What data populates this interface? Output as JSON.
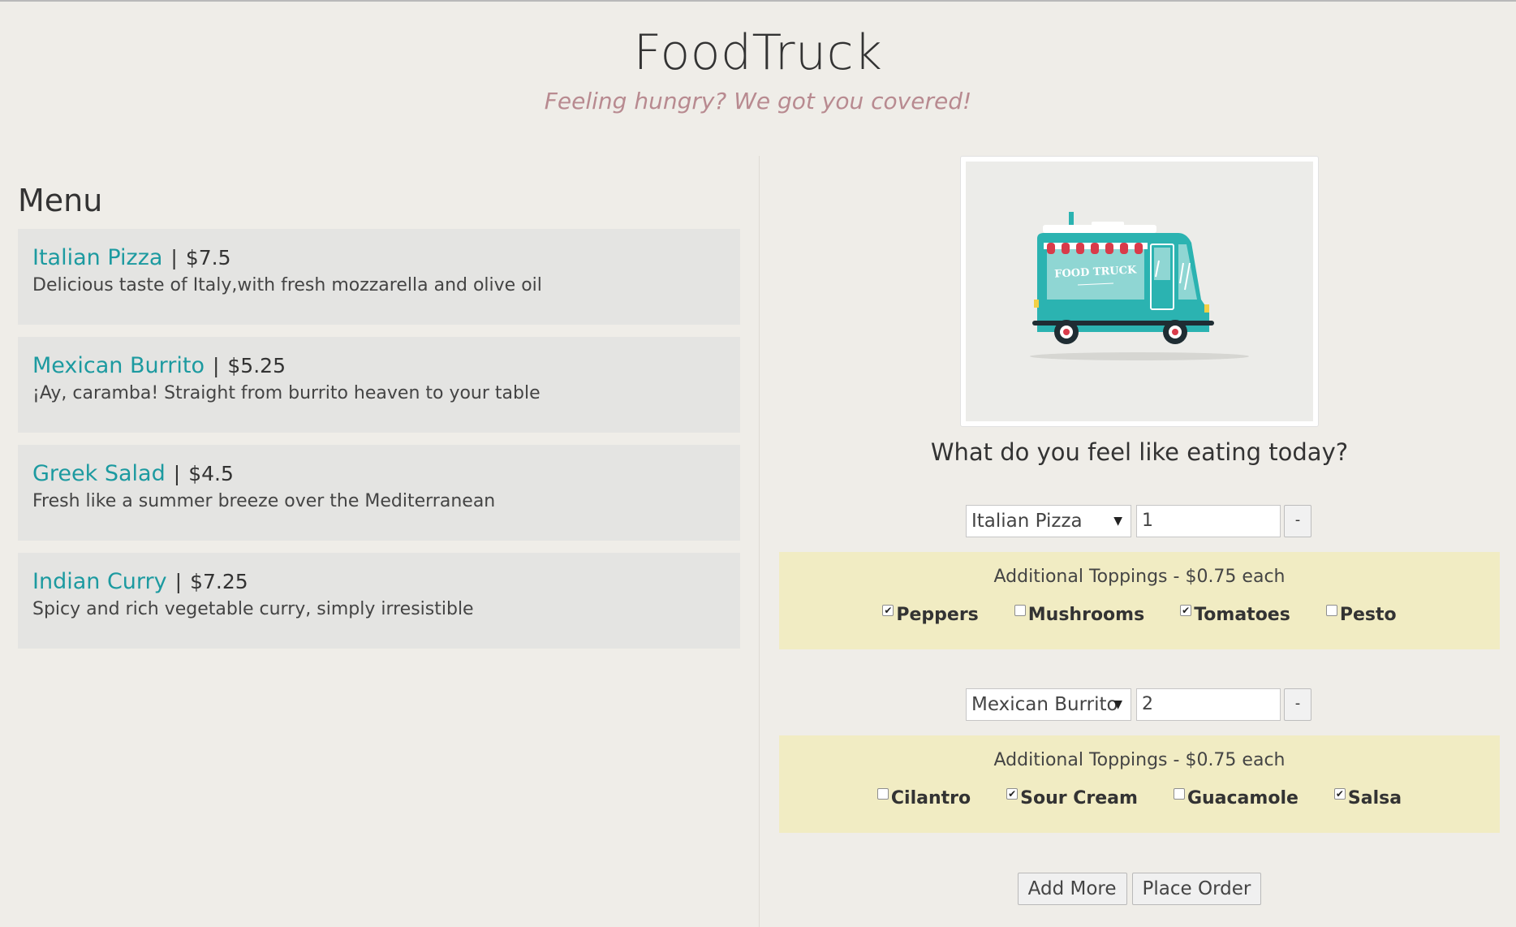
{
  "header": {
    "title": "FoodTruck",
    "tagline": "Feeling hungry? We got you covered!"
  },
  "menu": {
    "heading": "Menu",
    "items": [
      {
        "name": "Italian Pizza",
        "price": "$7.5",
        "description": "Delicious taste of Italy,with fresh mozzarella and olive oil"
      },
      {
        "name": "Mexican Burrito",
        "price": "$5.25",
        "description": "¡Ay, caramba! Straight from burrito heaven to your table"
      },
      {
        "name": "Greek Salad",
        "price": "$4.5",
        "description": "Fresh like a summer breeze over the Mediterranean"
      },
      {
        "name": "Indian Curry",
        "price": "$7.25",
        "description": "Spicy and rich vegetable curry, simply irresistible"
      }
    ]
  },
  "order": {
    "image": {
      "text": "FOOD TRUCK",
      "icon": "food-truck-illustration"
    },
    "question": "What do you feel like eating today?",
    "separator": "|",
    "rows": [
      {
        "selected": "Italian Pizza",
        "quantity": "1",
        "remove_label": "-",
        "toppings_title": "Additional Toppings - $0.75 each",
        "toppings": [
          {
            "label": "Peppers",
            "checked": true
          },
          {
            "label": "Mushrooms",
            "checked": false
          },
          {
            "label": "Tomatoes",
            "checked": true
          },
          {
            "label": "Pesto",
            "checked": false
          }
        ]
      },
      {
        "selected": "Mexican Burrito",
        "quantity": "2",
        "remove_label": "-",
        "toppings_title": "Additional Toppings - $0.75 each",
        "toppings": [
          {
            "label": "Cilantro",
            "checked": false
          },
          {
            "label": "Sour Cream",
            "checked": true
          },
          {
            "label": "Guacamole",
            "checked": false
          },
          {
            "label": "Salsa",
            "checked": true
          }
        ]
      }
    ],
    "add_more_label": "Add More",
    "place_order_label": "Place Order"
  },
  "colors": {
    "background": "#efede8",
    "accent": "#1c9aa0",
    "tagline": "#b88a90",
    "toppings_bg": "#f1ecc3",
    "card_bg": "#e4e4e2",
    "truck_body": "#2bb3b1",
    "awning_red": "#d93b4a"
  }
}
